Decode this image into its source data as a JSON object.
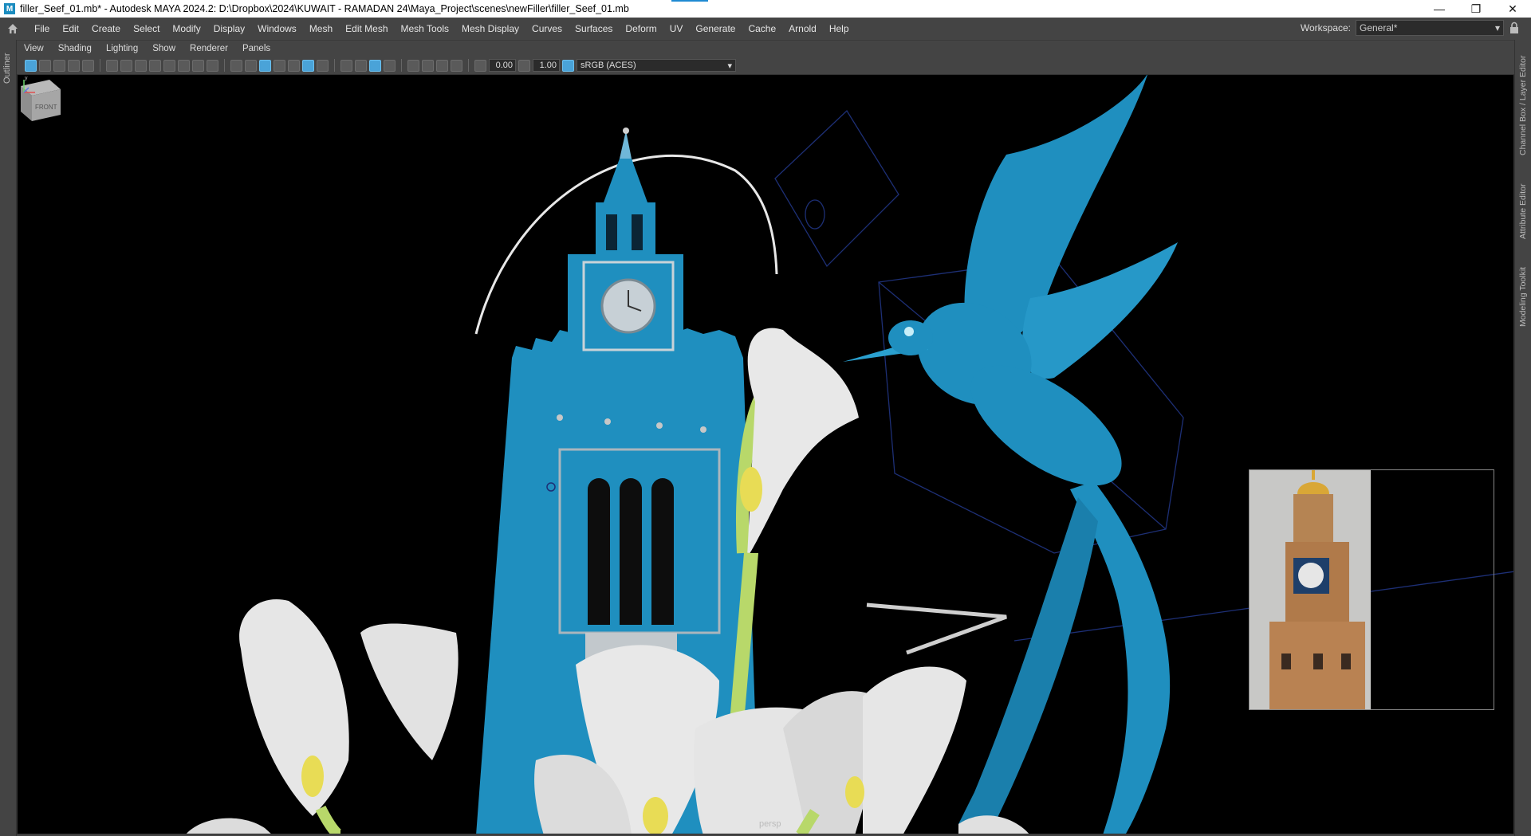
{
  "window": {
    "title": "filler_Seef_01.mb* - Autodesk MAYA 2024.2: D:\\Dropbox\\2024\\KUWAIT - RAMADAN 24\\Maya_Project\\scenes\\newFiller\\filler_Seef_01.mb",
    "app_icon_letter": "M",
    "buttons": {
      "minimize": "—",
      "maximize": "❐",
      "close": "✕"
    }
  },
  "menubar": {
    "items": [
      "File",
      "Edit",
      "Create",
      "Select",
      "Modify",
      "Display",
      "Windows",
      "Mesh",
      "Edit Mesh",
      "Mesh Tools",
      "Mesh Display",
      "Curves",
      "Surfaces",
      "Deform",
      "UV",
      "Generate",
      "Cache",
      "Arnold",
      "Help"
    ],
    "workspace_label": "Workspace:",
    "workspace_value": "General*"
  },
  "side_tabs": {
    "left": [
      "Outliner"
    ],
    "right": [
      "Channel Box / Layer Editor",
      "Attribute Editor",
      "Modeling Toolkit"
    ]
  },
  "panel_menu": [
    "View",
    "Shading",
    "Lighting",
    "Show",
    "Renderer",
    "Panels"
  ],
  "panel_toolbar": {
    "exposure": "0.00",
    "gamma": "1.00",
    "color_management": "sRGB (ACES)"
  },
  "viewport": {
    "camera": "persp",
    "viewcube_face": "FRONT",
    "axis_y": "y",
    "axis_x": "x",
    "colors": {
      "model_blue": "#1f8fbf",
      "lily_white": "#e6e6e6",
      "lily_yellow": "#e8dc55",
      "stem_green": "#b8d86a",
      "background": "#000000"
    }
  }
}
